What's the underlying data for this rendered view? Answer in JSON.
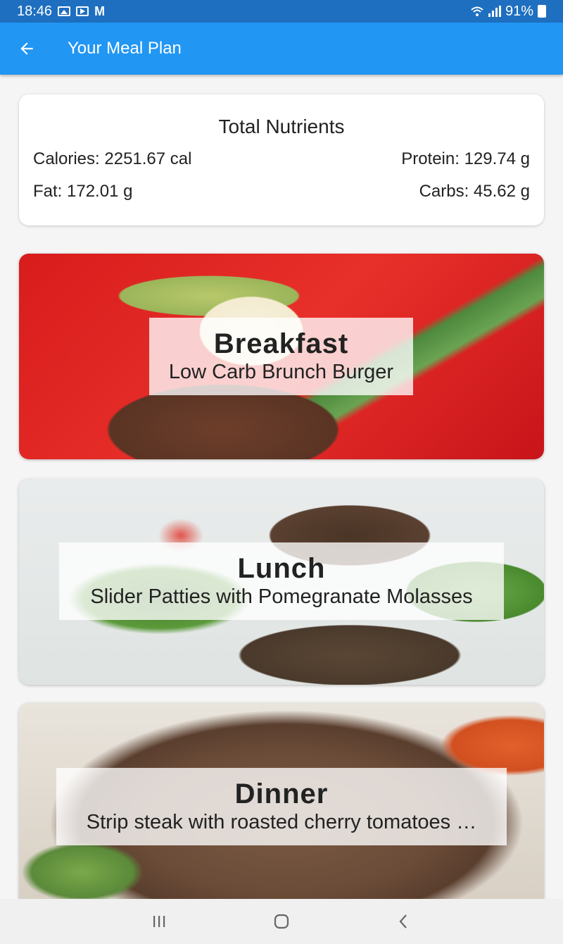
{
  "status_bar": {
    "time": "18:46",
    "notification_icons": [
      "image-icon",
      "youtube-icon",
      "gmail-icon"
    ],
    "battery": "91%"
  },
  "app_bar": {
    "title": "Your Meal Plan",
    "back_icon": "arrow-back-icon",
    "color": "#2196f3"
  },
  "nutrients": {
    "title": "Total Nutrients",
    "calories": "Calories: 2251.67 cal",
    "protein": "Protein: 129.74 g",
    "fat": "Fat: 172.01 g",
    "carbs": "Carbs: 45.62 g"
  },
  "meals": [
    {
      "heading": "Breakfast",
      "name": "Low Carb Brunch Burger"
    },
    {
      "heading": "Lunch",
      "name": "Slider Patties with Pomegranate Molasses"
    },
    {
      "heading": "Dinner",
      "name": "Strip steak with roasted cherry tomatoes …"
    }
  ],
  "nav_bar": {
    "buttons": [
      "recent-apps-icon",
      "home-icon",
      "back-icon"
    ]
  }
}
